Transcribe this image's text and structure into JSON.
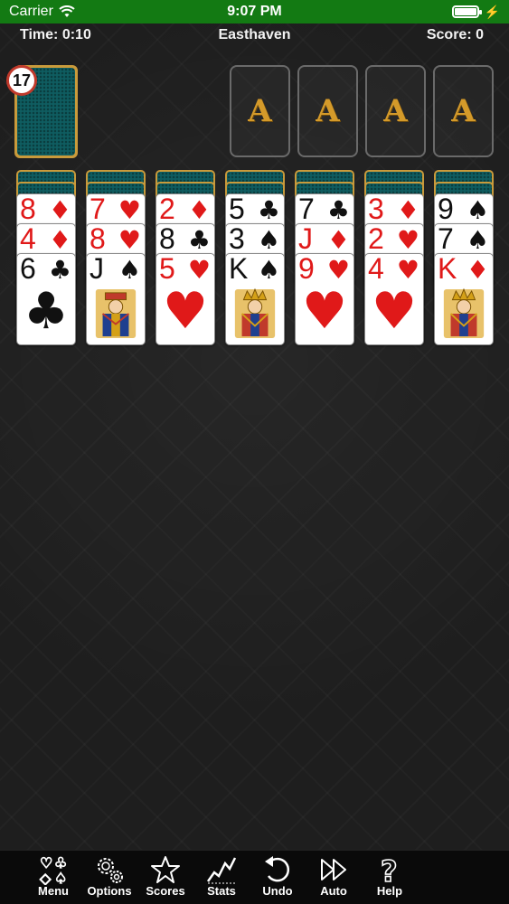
{
  "status_bar": {
    "carrier": "Carrier",
    "time": "9:07 PM"
  },
  "game": {
    "time_label": "Time: 0:10",
    "title": "Easthaven",
    "score_label": "Score: 0"
  },
  "stock": {
    "count": "17"
  },
  "foundations": [
    "A",
    "A",
    "A",
    "A"
  ],
  "tableau": [
    {
      "hidden": 2,
      "cards": [
        {
          "rank": "8",
          "suit": "♦",
          "color": "red"
        },
        {
          "rank": "4",
          "suit": "♦",
          "color": "red"
        },
        {
          "rank": "6",
          "suit": "♣",
          "color": "black",
          "top": true,
          "center": "♣"
        }
      ]
    },
    {
      "hidden": 2,
      "cards": [
        {
          "rank": "7",
          "suit": "♥",
          "color": "red"
        },
        {
          "rank": "8",
          "suit": "♥",
          "color": "red"
        },
        {
          "rank": "J",
          "suit": "♠",
          "color": "black",
          "top": true,
          "face": "jack"
        }
      ]
    },
    {
      "hidden": 2,
      "cards": [
        {
          "rank": "2",
          "suit": "♦",
          "color": "red"
        },
        {
          "rank": "8",
          "suit": "♣",
          "color": "black"
        },
        {
          "rank": "5",
          "suit": "♥",
          "color": "red",
          "top": true,
          "center": "♥"
        }
      ]
    },
    {
      "hidden": 2,
      "cards": [
        {
          "rank": "5",
          "suit": "♣",
          "color": "black"
        },
        {
          "rank": "3",
          "suit": "♠",
          "color": "black"
        },
        {
          "rank": "K",
          "suit": "♠",
          "color": "black",
          "top": true,
          "face": "king"
        }
      ]
    },
    {
      "hidden": 2,
      "cards": [
        {
          "rank": "7",
          "suit": "♣",
          "color": "black"
        },
        {
          "rank": "J",
          "suit": "♦",
          "color": "red"
        },
        {
          "rank": "9",
          "suit": "♥",
          "color": "red",
          "top": true,
          "center": "♥"
        }
      ]
    },
    {
      "hidden": 2,
      "cards": [
        {
          "rank": "3",
          "suit": "♦",
          "color": "red"
        },
        {
          "rank": "2",
          "suit": "♥",
          "color": "red"
        },
        {
          "rank": "4",
          "suit": "♥",
          "color": "red",
          "top": true,
          "center": "♥"
        }
      ]
    },
    {
      "hidden": 2,
      "cards": [
        {
          "rank": "9",
          "suit": "♠",
          "color": "black"
        },
        {
          "rank": "7",
          "suit": "♠",
          "color": "black"
        },
        {
          "rank": "K",
          "suit": "♦",
          "color": "red",
          "top": true,
          "face": "king"
        }
      ]
    }
  ],
  "toolbar": {
    "menu": "Menu",
    "options": "Options",
    "scores": "Scores",
    "stats": "Stats",
    "undo": "Undo",
    "auto": "Auto",
    "help": "Help"
  },
  "colors": {
    "status_bar": "#137a13",
    "card_back": "#0f5d60",
    "gold": "#c99a3b",
    "red_suit": "#e01919"
  }
}
